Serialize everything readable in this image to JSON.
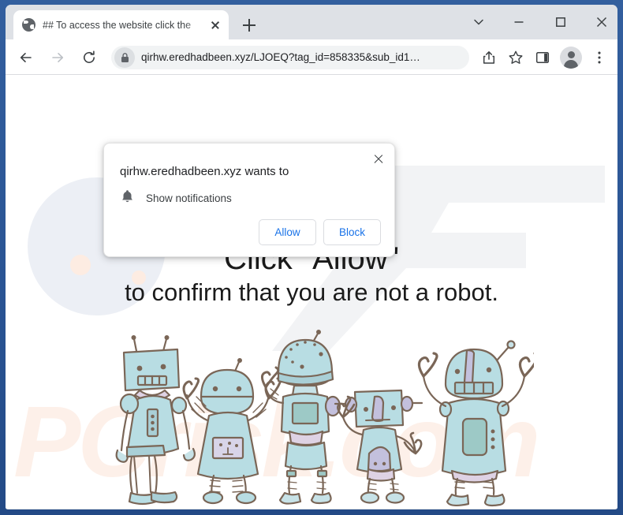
{
  "window": {
    "controls": {
      "tab_search": "tab-search",
      "minimize": "minimize",
      "maximize": "maximize",
      "close": "close"
    }
  },
  "tabstrip": {
    "tabs": [
      {
        "title": "## To access the website click the",
        "favicon": "globe-icon",
        "active": true
      }
    ],
    "new_tab_label": "+"
  },
  "toolbar": {
    "back": "back-arrow-icon",
    "forward": "forward-arrow-icon",
    "reload": "reload-icon",
    "omnibox": {
      "lock": "lock-icon",
      "url": "qirhw.eredhadbeen.xyz/LJOEQ?tag_id=858335&sub_id1…",
      "domain": "qirhw.eredhadbeen.xyz",
      "path": "/LJOEQ?tag_id=858335&sub_id1…"
    },
    "share": "share-icon",
    "bookmark": "star-icon",
    "side_panel": "side-panel-icon",
    "profile": "avatar-icon",
    "menu": "three-dot-menu-icon"
  },
  "permission_dialog": {
    "title": "qirhw.eredhadbeen.xyz wants to",
    "permission_icon": "bell-icon",
    "permission_label": "Show notifications",
    "allow_label": "Allow",
    "block_label": "Block",
    "close_label": "close-icon"
  },
  "page": {
    "headline": "Click \"Allow\"",
    "subline": "to confirm that you are not a robot.",
    "watermark_text": "PCrisk.com",
    "illustration": "five-cartoon-robots"
  },
  "colors": {
    "window_frame": "#2a5494",
    "tabstrip_bg": "#dee1e6",
    "toolbar_bg": "#ffffff",
    "omnibox_bg": "#f1f3f4",
    "accent_blue": "#1a73e8",
    "text_primary": "#202124",
    "robot_fill": "#b8dde3",
    "robot_outline": "#7a6657",
    "robot_accent": "#c3c0dd",
    "deco_circle": "#eceff5",
    "blob": "#fdece2",
    "watermark": "#f1f2f4"
  }
}
